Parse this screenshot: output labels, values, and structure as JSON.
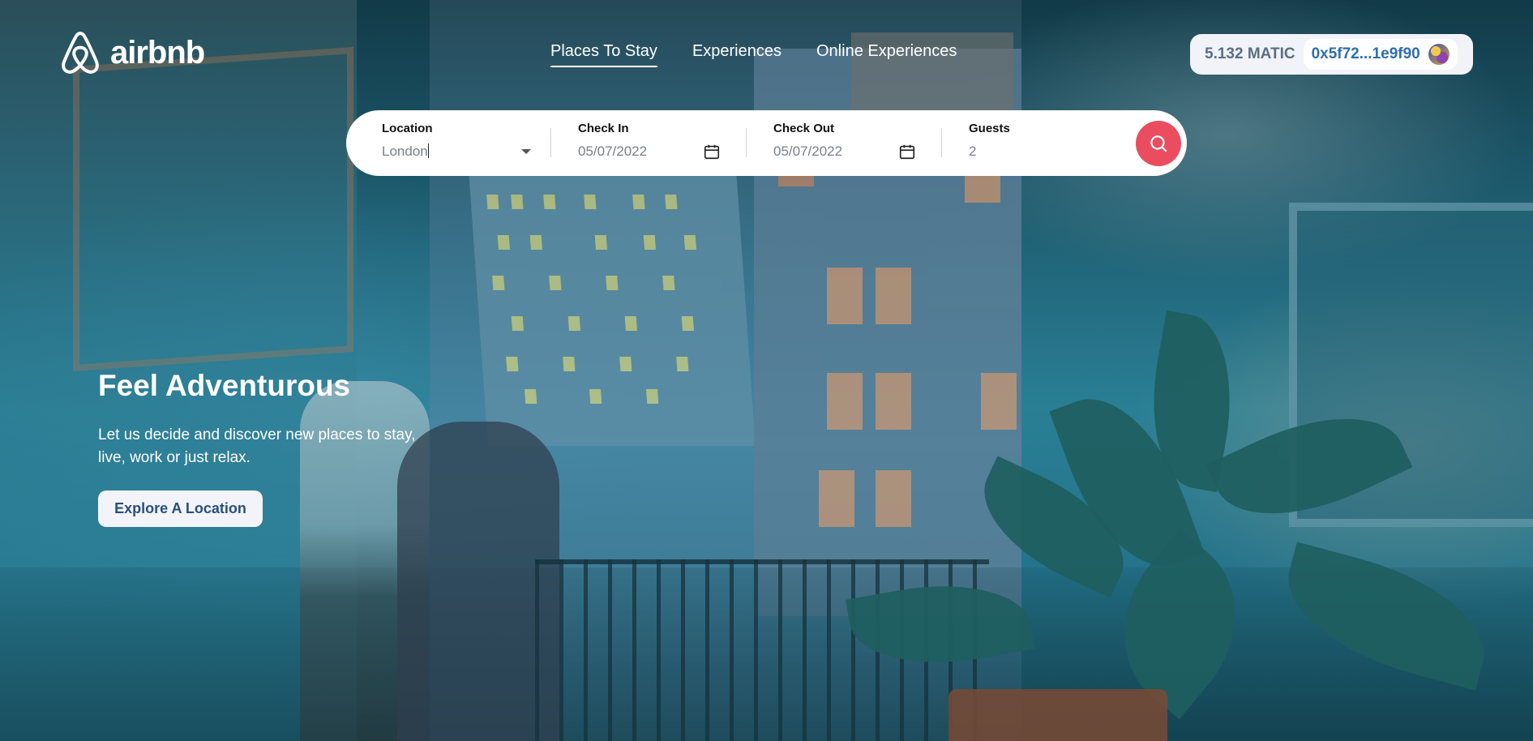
{
  "brand": {
    "name": "airbnb"
  },
  "nav": {
    "items": [
      "Places To Stay",
      "Experiences",
      "Online Experiences"
    ],
    "active_index": 0
  },
  "wallet": {
    "balance": "5.132 MATIC",
    "address": "0x5f72...1e9f90"
  },
  "search": {
    "location": {
      "label": "Location",
      "value": "London"
    },
    "check_in": {
      "label": "Check In",
      "value": "05/07/2022"
    },
    "check_out": {
      "label": "Check Out",
      "value": "05/07/2022"
    },
    "guests": {
      "label": "Guests",
      "value": "2"
    }
  },
  "hero": {
    "title": "Feel Adventurous",
    "subtitle": "Let us decide and discover new places to stay, live, work or just relax.",
    "cta_label": "Explore A Location"
  },
  "colors": {
    "accent": "#ea4d5f",
    "wallet_bg": "#f1f3f9",
    "address": "#2f6eb0"
  },
  "icons": [
    "airbnb-logo-icon",
    "calendar-icon",
    "chevron-down-icon",
    "search-icon",
    "wallet-avatar-icon"
  ]
}
